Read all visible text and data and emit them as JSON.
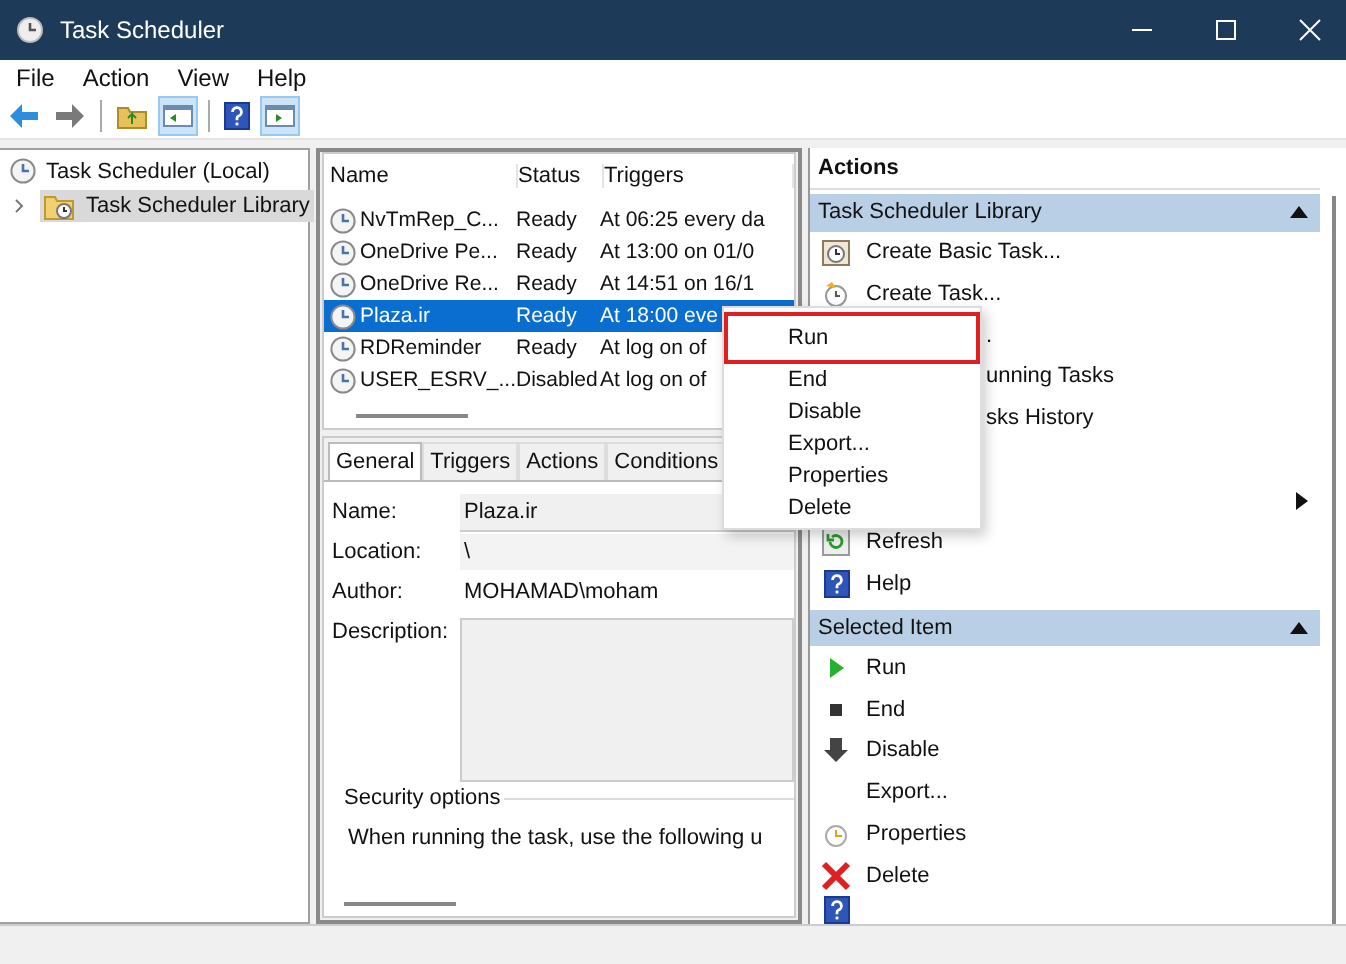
{
  "window": {
    "title": "Task Scheduler"
  },
  "menu_bar": [
    "File",
    "Action",
    "View",
    "Help"
  ],
  "toolbar": [
    {
      "kind": "back",
      "pressed": false
    },
    {
      "kind": "forward",
      "pressed": false
    },
    {
      "kind": "separator"
    },
    {
      "kind": "folder-up",
      "pressed": false
    },
    {
      "kind": "pane-left",
      "pressed": true
    },
    {
      "kind": "separator"
    },
    {
      "kind": "help",
      "pressed": false
    },
    {
      "kind": "pane-right",
      "pressed": true
    }
  ],
  "tree": [
    {
      "label": "Task Scheduler (Local)",
      "kind": "clock",
      "selected": false,
      "children": [
        {
          "label": "Task Scheduler Library",
          "kind": "folder",
          "selected": true,
          "expanded": false
        }
      ]
    }
  ],
  "task_list": {
    "columns": [
      "Name",
      "Status",
      "Triggers"
    ],
    "rows": [
      {
        "name": "NvTmRep_C...",
        "status": "Ready",
        "trigger": "At 06:25 every da",
        "selected": false
      },
      {
        "name": "OneDrive Pe...",
        "status": "Ready",
        "trigger": "At 13:00 on 01/0",
        "selected": false
      },
      {
        "name": "OneDrive Re...",
        "status": "Ready",
        "trigger": "At 14:51 on 16/1",
        "selected": false
      },
      {
        "name": "Plaza.ir",
        "status": "Ready",
        "trigger": "At 18:00 eve",
        "selected": true
      },
      {
        "name": "RDReminder",
        "status": "Ready",
        "trigger": "At log on of",
        "selected": false
      },
      {
        "name": "USER_ESRV_...",
        "status": "Disabled",
        "trigger": "At log on of",
        "selected": false
      }
    ]
  },
  "detail": {
    "tabs": [
      {
        "label": "General",
        "selected": true
      },
      {
        "label": "Triggers",
        "selected": false
      },
      {
        "label": "Actions",
        "selected": false
      },
      {
        "label": "Conditions",
        "selected": false
      }
    ],
    "fields": [
      {
        "label": "Name:",
        "value": "Plaza.ir",
        "kind": "box"
      },
      {
        "label": "Location:",
        "value": "\\",
        "kind": "flat"
      },
      {
        "label": "Author:",
        "value": "MOHAMAD\\moham",
        "kind": "plain"
      },
      {
        "label": "Description:",
        "kind": "area"
      }
    ],
    "security": {
      "title": "Security options",
      "text": "When running the task, use the following u"
    }
  },
  "actions": {
    "title": "Actions",
    "sections": [
      {
        "title": "Task Scheduler Library",
        "expanded": true,
        "items": [
          {
            "kind": "basic-task",
            "label": "Create Basic Task..."
          },
          {
            "kind": "task",
            "label": "Create Task..."
          },
          {
            "kind": "covered",
            "label": "."
          },
          {
            "kind": "covered",
            "label": "unning Tasks"
          },
          {
            "kind": "covered",
            "label": "sks History"
          },
          {
            "kind": "hidden"
          },
          {
            "kind": "covered-submenu"
          },
          {
            "kind": "refresh",
            "label": "Refresh"
          },
          {
            "kind": "help",
            "label": "Help"
          }
        ]
      },
      {
        "title": "Selected Item",
        "expanded": true,
        "items": [
          {
            "kind": "play",
            "label": "Run"
          },
          {
            "kind": "stop",
            "label": "End"
          },
          {
            "kind": "down",
            "label": "Disable"
          },
          {
            "kind": "plain",
            "label": "Export..."
          },
          {
            "kind": "clock",
            "label": "Properties"
          },
          {
            "kind": "delete",
            "label": "Delete"
          },
          {
            "kind": "cut-help"
          }
        ]
      }
    ]
  },
  "context_menu": {
    "items": [
      {
        "label": "Run",
        "highlighted": true
      },
      {
        "label": "End",
        "highlighted": false
      },
      {
        "label": "Disable",
        "highlighted": false
      },
      {
        "label": "Export...",
        "highlighted": false
      },
      {
        "label": "Properties",
        "highlighted": false
      },
      {
        "label": "Delete",
        "highlighted": false
      }
    ]
  }
}
